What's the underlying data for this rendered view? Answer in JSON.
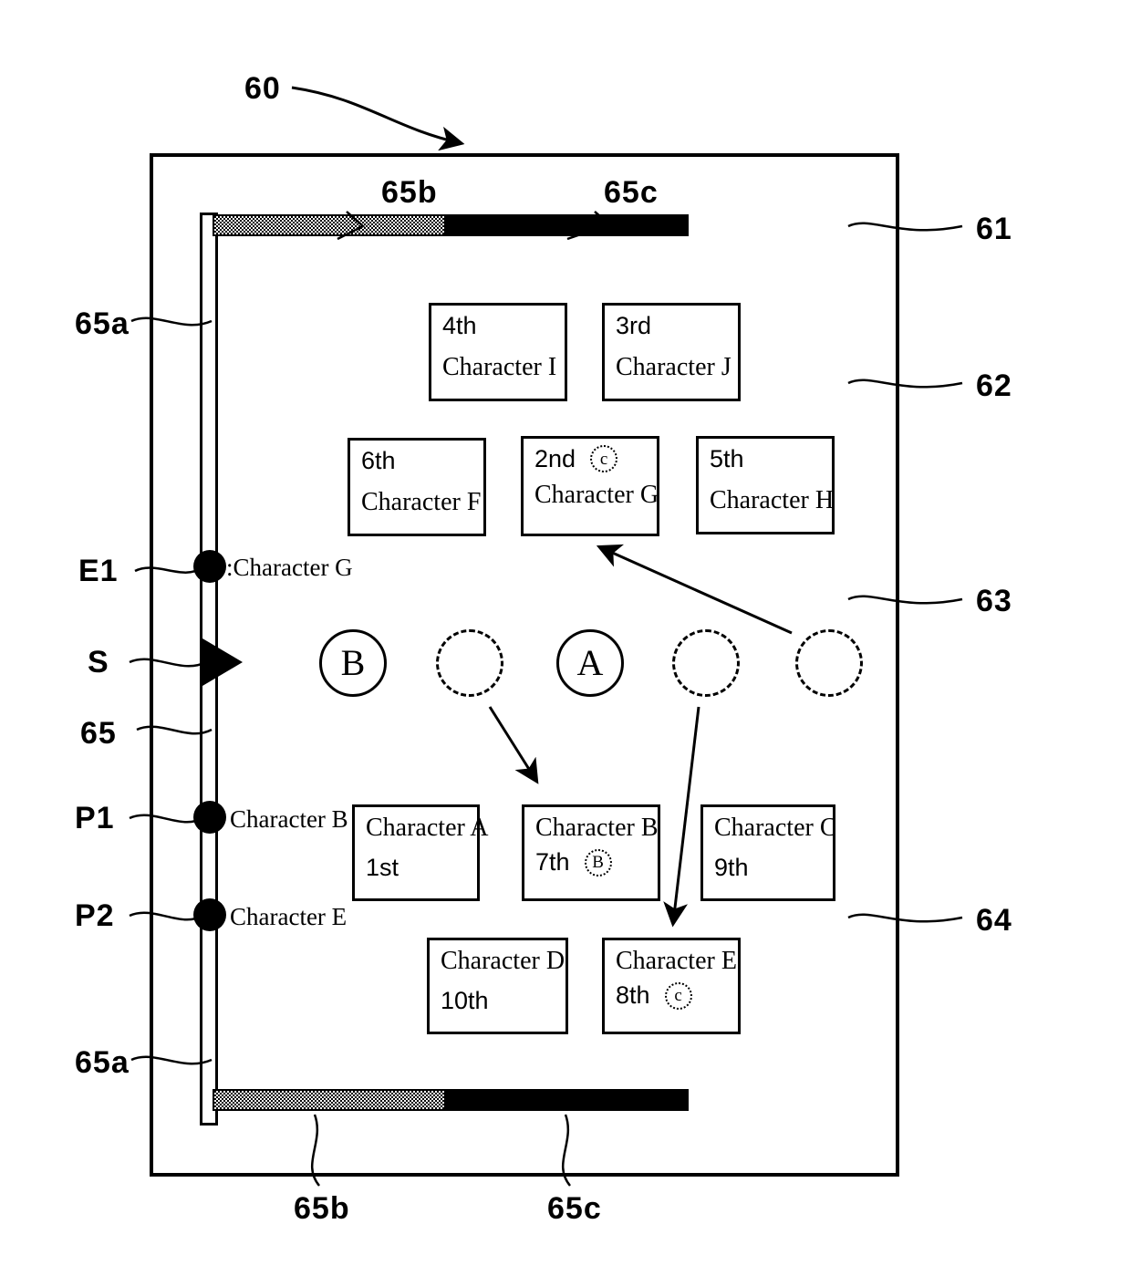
{
  "figure": {
    "device_ref": "60",
    "refs_right": [
      {
        "label": "61"
      },
      {
        "label": "62"
      },
      {
        "label": "63"
      },
      {
        "label": "64"
      }
    ],
    "rail_refs": {
      "top_gray": "65b",
      "top_black": "65c",
      "bottom_gray": "65b",
      "bottom_black": "65c",
      "rail_upper": "65a",
      "rail_lower": "65a",
      "rail_mid": "65"
    },
    "rail_markers": [
      {
        "id": "E1",
        "label": "E1",
        "text": ":Character G",
        "type": "dot"
      },
      {
        "id": "S",
        "label": "S",
        "text": "",
        "type": "triangle"
      },
      {
        "id": "P1",
        "label": "P1",
        "text": "Character B",
        "type": "dot"
      },
      {
        "id": "P2",
        "label": "P2",
        "text": "Character E",
        "type": "dot"
      }
    ]
  },
  "upper_boxes": [
    {
      "rank": "4th",
      "name": "Character I",
      "badge": ""
    },
    {
      "rank": "3rd",
      "name": "Character J",
      "badge": ""
    },
    {
      "rank": "6th",
      "name": "Character F",
      "badge": ""
    },
    {
      "rank": "2nd",
      "name": "Character G",
      "badge": "c"
    },
    {
      "rank": "5th",
      "name": "Character H",
      "badge": ""
    }
  ],
  "lower_boxes": [
    {
      "name": "Character A",
      "rank": "1st",
      "badge": ""
    },
    {
      "name": "Character B",
      "rank": "7th",
      "badge": "B"
    },
    {
      "name": "Character C",
      "rank": "9th",
      "badge": ""
    },
    {
      "name": "Character D",
      "rank": "10th",
      "badge": ""
    },
    {
      "name": "Character E",
      "rank": "8th",
      "badge": "c"
    }
  ],
  "circles": [
    {
      "label": "B",
      "style": "solid"
    },
    {
      "label": "",
      "style": "dashed"
    },
    {
      "label": "A",
      "style": "solid"
    },
    {
      "label": "",
      "style": "dashed"
    },
    {
      "label": "",
      "style": "dashed"
    }
  ],
  "colors": {
    "ink": "#000000",
    "paper": "#ffffff",
    "bar_filled": "#000000",
    "bar_hatched": "#9a9a9a"
  }
}
